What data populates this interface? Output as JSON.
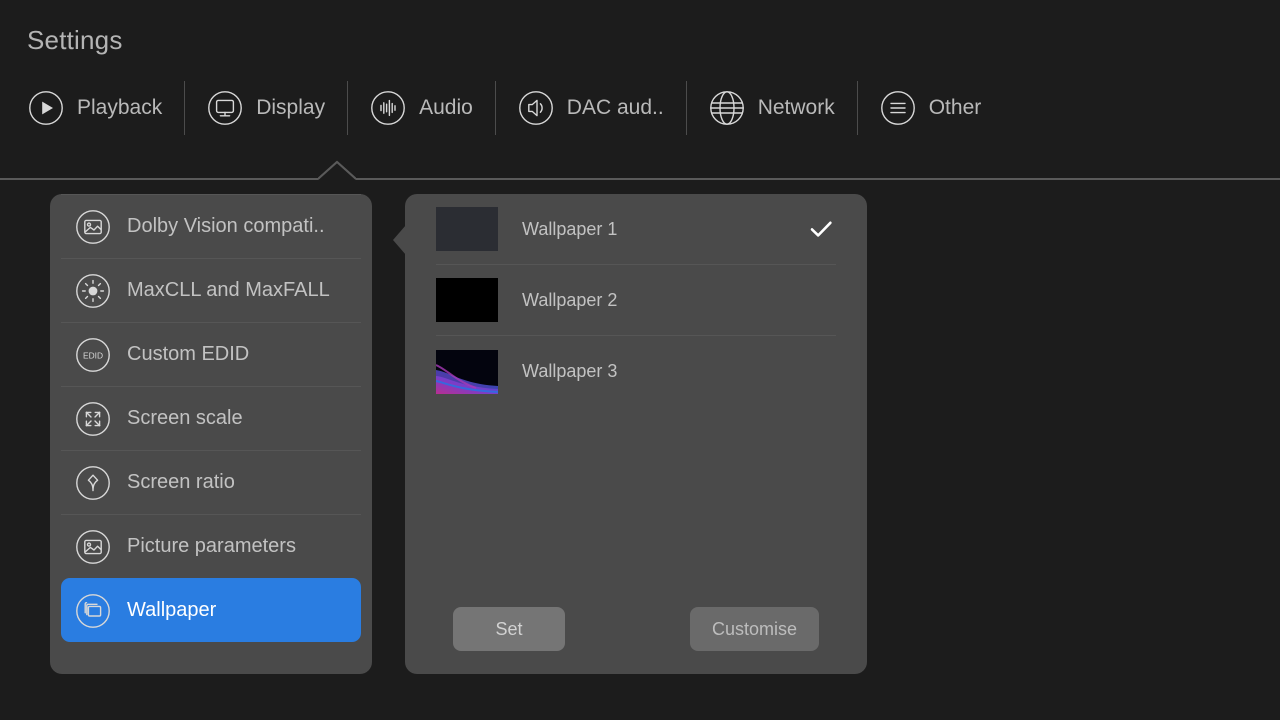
{
  "header": {
    "title": "Settings",
    "tabs": [
      {
        "label": "Playback",
        "icon": "play-circle-icon",
        "active": false
      },
      {
        "label": "Display",
        "icon": "monitor-icon",
        "active": true
      },
      {
        "label": "Audio",
        "icon": "equalizer-icon",
        "active": false
      },
      {
        "label": "DAC aud..",
        "icon": "speaker-icon",
        "active": false
      },
      {
        "label": "Network",
        "icon": "globe-icon",
        "active": false
      },
      {
        "label": "Other",
        "icon": "hamburger-icon",
        "active": false
      }
    ]
  },
  "sidebar": {
    "items": [
      {
        "label": "Dolby Vision compati..",
        "icon": "image-icon",
        "selected": false
      },
      {
        "label": "MaxCLL and MaxFALL",
        "icon": "brightness-icon",
        "selected": false
      },
      {
        "label": "Custom EDID",
        "icon": "edid-icon",
        "selected": false
      },
      {
        "label": "Screen scale",
        "icon": "expand-icon",
        "selected": false
      },
      {
        "label": "Screen ratio",
        "icon": "ratio-arrow-icon",
        "selected": false
      },
      {
        "label": "Picture parameters",
        "icon": "image-icon",
        "selected": false
      },
      {
        "label": "Wallpaper",
        "icon": "layers-icon",
        "selected": true
      }
    ]
  },
  "detail": {
    "wallpapers": [
      {
        "label": "Wallpaper 1",
        "thumb": "thumb-wp1",
        "checked": true
      },
      {
        "label": "Wallpaper 2",
        "thumb": "thumb-wp2",
        "checked": false
      },
      {
        "label": "Wallpaper 3",
        "thumb": "thumb-wp3",
        "checked": false
      }
    ],
    "set_label": "Set",
    "customise_label": "Customise"
  },
  "colors": {
    "background": "#1c1c1c",
    "panel": "#4a4a4a",
    "accent": "#2a7de1",
    "text": "#c2c2c2",
    "divider": "#565656"
  }
}
